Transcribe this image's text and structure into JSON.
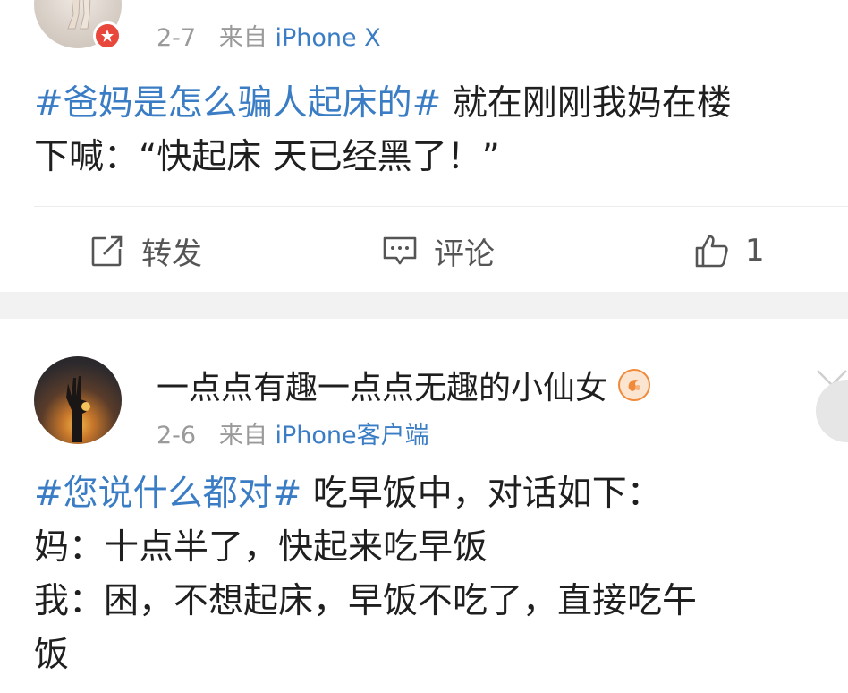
{
  "post1": {
    "meta": {
      "date": "2-7",
      "from": "来自",
      "source": "iPhone X"
    },
    "content": {
      "tag": "#爸妈是怎么骗人起床的#",
      "line1_rest": " 就在刚刚我妈在楼",
      "line2": "下喊：“快起床 天已经黑了！”"
    },
    "actions": {
      "repost_label": "转发",
      "comment_label": "评论",
      "like_count": "1"
    }
  },
  "post2": {
    "username": "一点点有趣一点点无趣的小仙女",
    "meta": {
      "date": "2-6",
      "from": "来自",
      "source": "iPhone客户端"
    },
    "content": {
      "tag": "#您说什么都对#",
      "line1_rest": " 吃早饭中，对话如下：",
      "line2": "妈：十点半了，快起来吃早饭",
      "line3": "我：困，不想起床，早饭不吃了，直接吃午",
      "line4": "饭"
    }
  },
  "icons": {
    "badge": "red-star-badge-icon",
    "repost": "repost-icon",
    "comment": "comment-icon",
    "like": "thumbs-up-icon",
    "vip": "vip-medal-icon",
    "menu": "chevron-down-icon"
  },
  "colors": {
    "link": "#3a7dc5",
    "text": "#1f1f1f",
    "meta": "#9a9a9a",
    "separator": "#f2f2f2"
  }
}
